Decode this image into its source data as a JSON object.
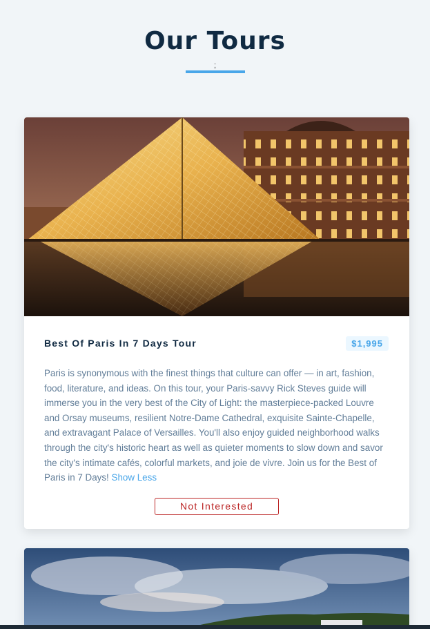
{
  "header": {
    "title": "Our Tours",
    "stray_char": ";"
  },
  "tours": [
    {
      "name": "Best Of Paris In 7 Days Tour",
      "price": "$1,995",
      "info": "Paris is synonymous with the finest things that culture can offer — in art, fashion, food, literature, and ideas. On this tour, your Paris-savvy Rick Steves guide will immerse you in the very best of the City of Light: the masterpiece-packed Louvre and Orsay museums, resilient Notre-Dame Cathedral, exquisite Sainte-Chapelle, and extravagant Palace of Versailles. You'll also enjoy guided neighborhood walks through the city's historic heart as well as quieter moments to slow down and savor the city's intimate cafés, colorful markets, and joie de vivre. Join us for the Best of Paris in 7 Days!",
      "toggle_label": "Show Less",
      "remove_label": "Not Interested",
      "image_alt": "Louvre pyramid at dusk"
    },
    {
      "image_alt": "Cloudy sky over green hills"
    }
  ],
  "colors": {
    "accent": "#49a6e9",
    "title": "#102a42",
    "text": "#617d98",
    "danger": "#bb2525",
    "background": "#f1f5f8"
  }
}
